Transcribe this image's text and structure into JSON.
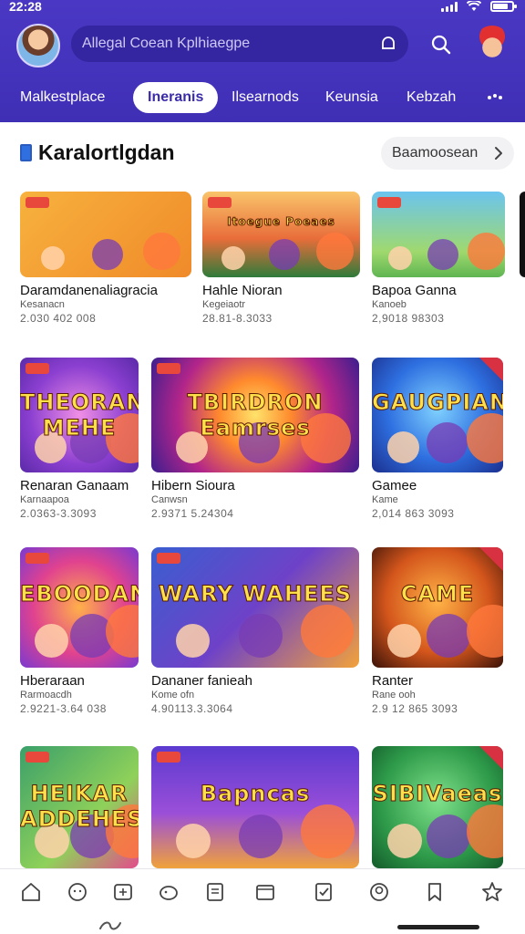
{
  "status": {
    "time": "22:28"
  },
  "search": {
    "placeholder": "Allegal Coean Kplhiaegpe"
  },
  "tabs": [
    {
      "label": "Malkestplace",
      "active": false
    },
    {
      "label": "Ineranis",
      "active": true
    },
    {
      "label": "Ilsearnods",
      "active": false
    },
    {
      "label": "Keunsia",
      "active": false
    },
    {
      "label": "Kebzah",
      "active": false
    }
  ],
  "section": {
    "title": "Karalortlgdan",
    "browse_label": "Baamoosean"
  },
  "cards": [
    {
      "name": "Daramdanenaliagracia",
      "sub": "Kesanacn",
      "meta": "2.030 402 008"
    },
    {
      "name": "Hahle Nioran",
      "sub": "Kegeiaotr",
      "meta": "28.81-8.3033"
    },
    {
      "name": "Bapoa Ganna",
      "sub": "Kanoeb",
      "meta": "2,9018 98303"
    },
    {
      "name": "Renaran Ganaam",
      "sub": "Karnaapoa",
      "meta": "2.0363-3.3093"
    },
    {
      "name": "Hibern Sioura",
      "sub": "Canwsn",
      "meta": "2.9371 5.24304"
    },
    {
      "name": "Gamee",
      "sub": "Kame",
      "meta": "2,014 863 3093"
    },
    {
      "name": "Hberaraan",
      "sub": "Rarmoacdh",
      "meta": "2.9221-3.64 038"
    },
    {
      "name": "Dananer fanieah",
      "sub": "Kome ofn",
      "meta": "4.90113.3.3064"
    },
    {
      "name": "Ranter",
      "sub": "Rane ooh",
      "meta": "2.9 12 865 3093"
    },
    {
      "name": "",
      "sub": "",
      "meta": ""
    },
    {
      "name": "",
      "sub": "",
      "meta": ""
    },
    {
      "name": "",
      "sub": "",
      "meta": ""
    }
  ],
  "card_art": [
    {
      "text": "",
      "bg": "linear-gradient(135deg,#f7b23d,#f08a2a)"
    },
    {
      "text": "Itoegue Poeaes",
      "bg": "linear-gradient(180deg,#f9c46a,#e86d3a 55%,#2e7b3a)"
    },
    {
      "text": "",
      "bg": "linear-gradient(180deg,#6bc4ef,#9fd96e 70%,#5fb552)"
    },
    {
      "text": "THEORAN MEHE",
      "bg": "radial-gradient(circle at 50% 50%,#f08fe6,#8b3fd0 60%,#5a2aa8)"
    },
    {
      "text": "TBIRDRON Eamrses",
      "bg": "radial-gradient(circle at 50% 50%,#ffe36a,#ff8a2d 30%,#b2258a 65%,#3b1e8e)"
    },
    {
      "text": "GAUGPIAN",
      "bg": "radial-gradient(circle at 50% 45%,#7fd1ff,#2e6fe0 55%,#1b2f8e)"
    },
    {
      "text": "EBOODAN",
      "bg": "radial-gradient(circle at 50% 50%,#ffb04a,#e0428f 55%,#7a3ad0)"
    },
    {
      "text": "WARY WAHEES",
      "bg": "linear-gradient(135deg,#3a5ed0,#6e42c8 50%,#f2a23a)"
    },
    {
      "text": "CAME",
      "bg": "radial-gradient(circle at 50% 45%,#ffb347,#d4561c 55%,#3a1208)"
    },
    {
      "text": "HEIKAR ADDEHES",
      "bg": "linear-gradient(135deg,#3aa06a,#8fd15a 60%,#e24d8b)"
    },
    {
      "text": "Bapncas",
      "bg": "linear-gradient(180deg,#5b3ad0,#9b4fd8 55%,#f0a23a)"
    },
    {
      "text": "SIBIVaeas",
      "bg": "radial-gradient(circle at 50% 45%,#7fe08a,#2e9b4a 60%,#145a2a)"
    }
  ],
  "colors": {
    "header": "#3f2fb5",
    "accent": "#2f6fe0",
    "tab_active_text": "#3a2ca8"
  },
  "bottom_nav_icons": [
    "home-icon",
    "chat-icon",
    "library-icon",
    "games-icon",
    "document-icon",
    "wallet-icon",
    "tasks-icon",
    "profile-icon",
    "bookmark-icon",
    "star-icon"
  ]
}
